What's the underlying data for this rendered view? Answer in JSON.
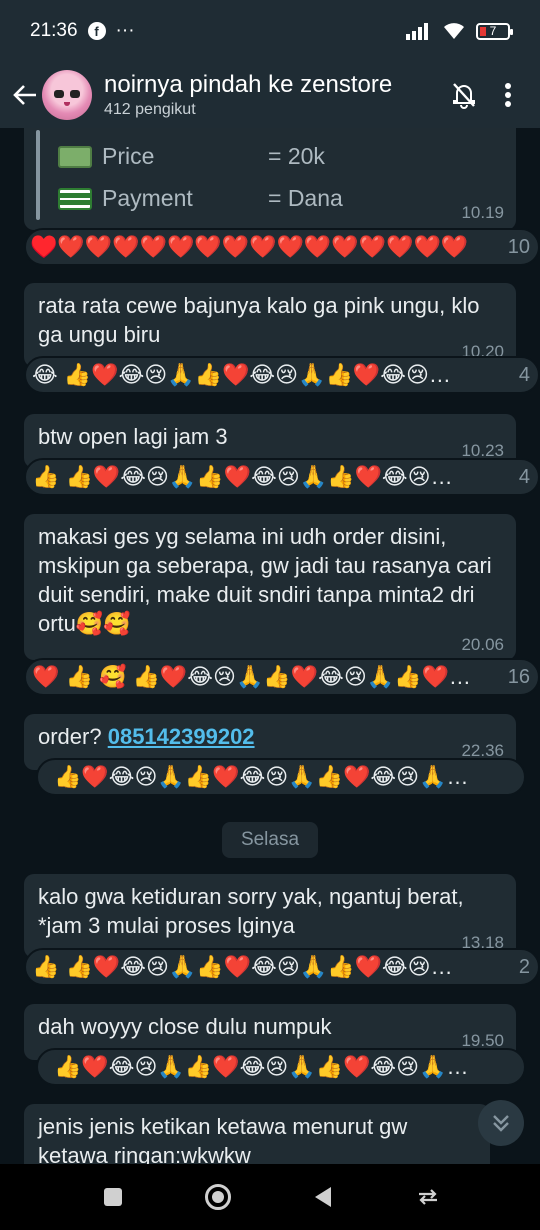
{
  "status_bar": {
    "time": "21:36",
    "dots": "···",
    "battery": "7"
  },
  "header": {
    "title": "noirnya pindah ke zenstore",
    "subtitle": "412 pengikut"
  },
  "quoted": {
    "price_label": "Price",
    "price_value": "= 20k",
    "payment_label": "Payment",
    "payment_value": "= Dana",
    "time": "10.19"
  },
  "reactions": {
    "r0": "♥️❤️❤️❤️❤️❤️❤️❤️❤️❤️❤️❤️❤️❤️❤️❤️",
    "r0_count": "10",
    "r1": "😂 👍❤️😂😢🙏👍❤️😂😢🙏👍❤️😂😢…",
    "r1_count": "4",
    "r2": "👍 👍❤️😂😢🙏👍❤️😂😢🙏👍❤️😂😢…",
    "r2_count": "4",
    "r3": "❤️ 👍 🥰 👍❤️😂😢🙏👍❤️😂😢🙏👍❤️…",
    "r3_count": "16",
    "r4": "👍❤️😂😢🙏👍❤️😂😢🙏👍❤️😂😢🙏…",
    "r5": "👍 👍❤️😂😢🙏👍❤️😂😢🙏👍❤️😂😢…",
    "r5_count": "2",
    "r6": "👍❤️😂😢🙏👍❤️😂😢🙏👍❤️😂😢🙏…"
  },
  "messages": [
    {
      "text": "rata rata cewe bajunya kalo ga pink ungu, klo ga ungu biru",
      "time": "10.20"
    },
    {
      "text": "btw open lagi jam 3",
      "time": "10.23"
    },
    {
      "text": "makasi ges yg selama ini udh order disini, mskipun ga seberapa, gw jadi tau rasanya cari duit sendiri, make duit sndiri tanpa minta2 dri ortu🥰🥰",
      "time": "20.06"
    },
    {
      "prefix": "order? ",
      "link": "085142399202",
      "time": "22.36"
    },
    {
      "text": "kalo gwa ketiduran sorry yak, ngantuj berat, *jam 3 mulai proses lginya",
      "time": "13.18"
    },
    {
      "text": "dah woyyy close dulu numpuk",
      "time": "19.50"
    },
    {
      "text": "jenis jenis ketikan ketawa menurut gw ketawa ringan:wkwkw"
    }
  ],
  "date_chip": "Selasa",
  "icons": {
    "back": "arrow-left-icon",
    "mute": "bell-off-icon",
    "menu": "more-vertical-icon",
    "scroll": "chevron-double-down-icon"
  }
}
